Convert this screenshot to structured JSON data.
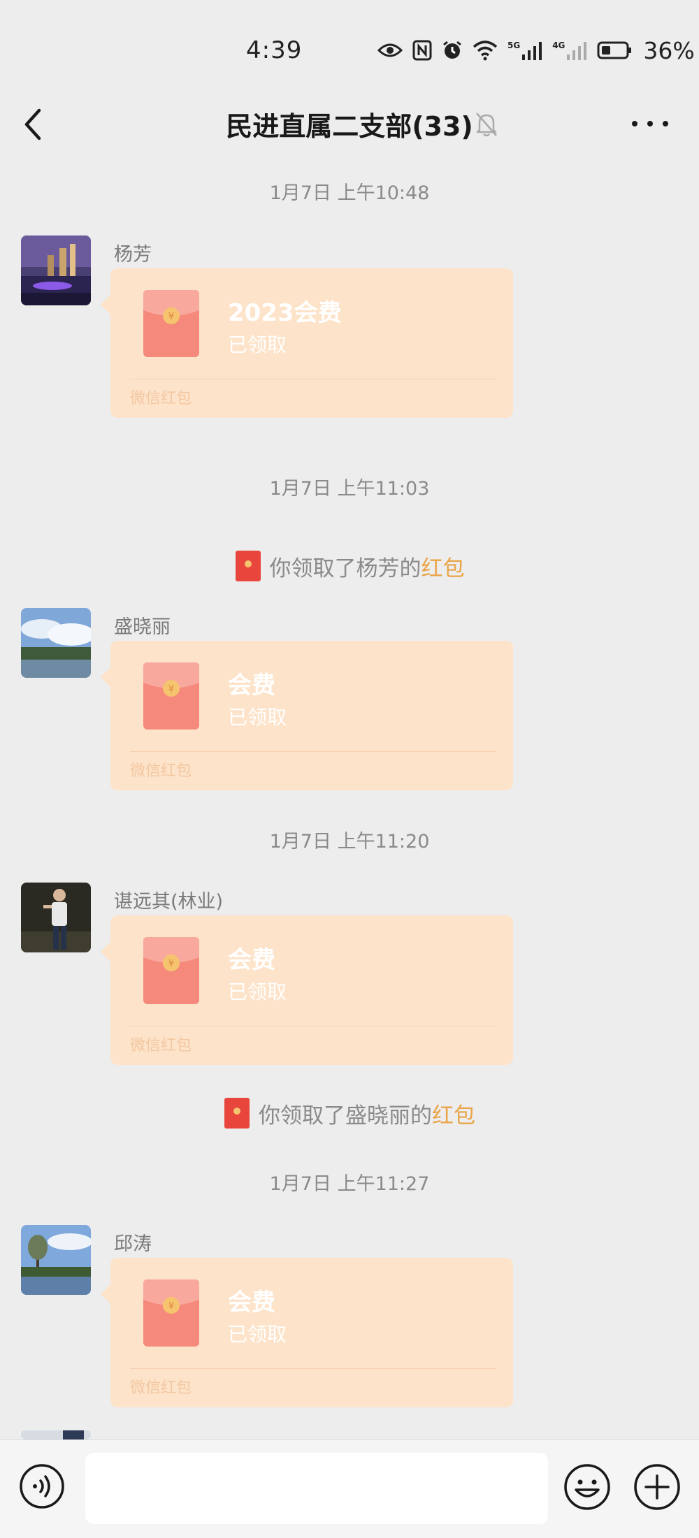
{
  "status_bar": {
    "time": "4:39",
    "battery": "36%",
    "signal_1": "5G",
    "signal_2": "4G"
  },
  "header": {
    "title": "民进直属二支部(33)"
  },
  "messages": [
    {
      "timestamp": "1月7日 上午10:48"
    },
    {
      "sender": "杨芳",
      "packet_title": "2023会费",
      "packet_status": "已领取",
      "packet_brand": "微信红包"
    },
    {
      "timestamp": "1月7日 上午11:03"
    },
    {
      "system_prefix": "你领取了杨芳的",
      "system_link": "红包"
    },
    {
      "sender": "盛晓丽",
      "packet_title": "会费",
      "packet_status": "已领取",
      "packet_brand": "微信红包"
    },
    {
      "timestamp": "1月7日 上午11:20"
    },
    {
      "sender": "谌远其(林业)",
      "packet_title": "会费",
      "packet_status": "已领取",
      "packet_brand": "微信红包"
    },
    {
      "system_prefix": "你领取了盛晓丽的",
      "system_link": "红包"
    },
    {
      "timestamp": "1月7日 上午11:27"
    },
    {
      "sender": "邱涛",
      "packet_title": "会费",
      "packet_status": "已领取",
      "packet_brand": "微信红包"
    }
  ],
  "colors": {
    "background": "#ededed",
    "packet": "#fde3c9",
    "envelope": "#f38a7c",
    "highlight": "#e9a447"
  },
  "icons": [
    "back-arrow-icon",
    "mute-bell-icon",
    "more-dots-icon",
    "red-packet-icon",
    "voice-icon",
    "emoji-icon",
    "plus-icon"
  ]
}
